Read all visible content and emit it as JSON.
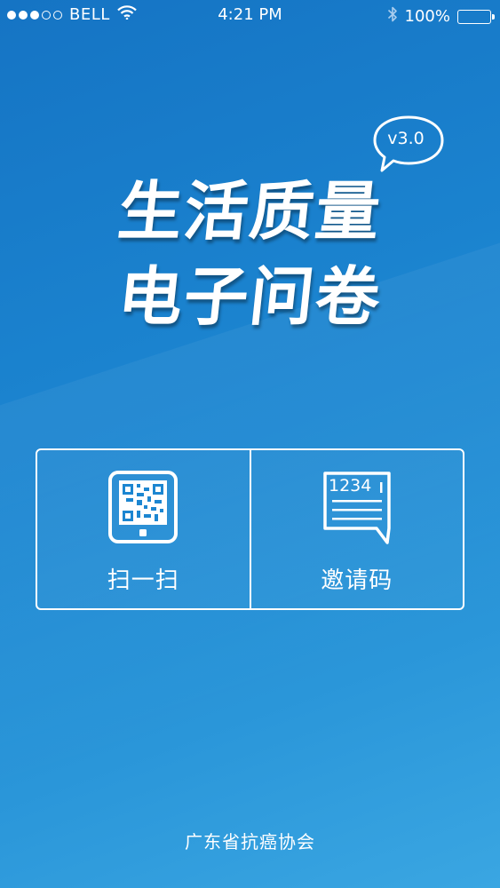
{
  "status_bar": {
    "carrier": "BELL",
    "time": "4:21 PM",
    "battery": "100%",
    "signal_icon": "signal-dots-icon",
    "wifi_icon": "wifi-icon",
    "bluetooth_icon": "bluetooth-icon",
    "battery_icon": "battery-icon"
  },
  "title": {
    "line1": "生活质量",
    "line2": "电子问卷",
    "version": "v3.0"
  },
  "actions": [
    {
      "label": "扫一扫",
      "icon": "qr-scan-tablet-icon"
    },
    {
      "label": "邀请码",
      "icon": "invite-code-message-icon",
      "icon_text": "1234"
    }
  ],
  "footer": {
    "text": "广东省抗癌协会"
  },
  "colors": {
    "background_top": "#1574c4",
    "background_bottom": "#3aa6e2",
    "foreground": "#ffffff"
  }
}
